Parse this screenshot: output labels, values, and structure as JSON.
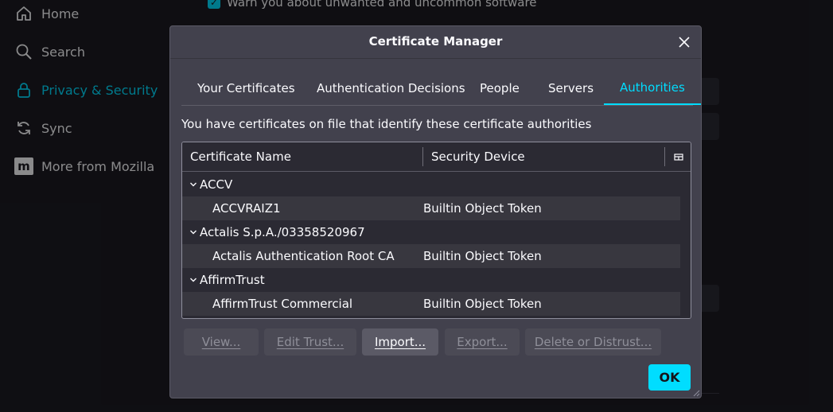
{
  "background": {
    "nav": [
      {
        "label": "Home",
        "icon": "home-icon"
      },
      {
        "label": "Search",
        "icon": "search-icon"
      },
      {
        "label": "Privacy & Security",
        "icon": "lock-icon",
        "active": true
      },
      {
        "label": "Sync",
        "icon": "sync-icon"
      },
      {
        "label": "More from Mozilla",
        "icon": "mozilla-icon"
      }
    ],
    "checkbox_label": "Warn you about unwanted and uncommon software",
    "mozilla_glyph": "m"
  },
  "dialog": {
    "title": "Certificate Manager",
    "tabs": [
      {
        "label": "Your Certificates"
      },
      {
        "label": "Authentication Decisions"
      },
      {
        "label": "People"
      },
      {
        "label": "Servers"
      },
      {
        "label": "Authorities",
        "active": true
      }
    ],
    "description": "You have certificates on file that identify these certificate authorities",
    "columns": [
      "Certificate Name",
      "Security Device"
    ],
    "rows": [
      {
        "type": "group",
        "name": "ACCV",
        "device": ""
      },
      {
        "type": "cert",
        "name": "ACCVRAIZ1",
        "device": "Builtin Object Token"
      },
      {
        "type": "group",
        "name": "Actalis S.p.A./03358520967",
        "device": ""
      },
      {
        "type": "cert",
        "name": "Actalis Authentication Root CA",
        "device": "Builtin Object Token"
      },
      {
        "type": "group",
        "name": "AffirmTrust",
        "device": ""
      },
      {
        "type": "cert",
        "name": "AffirmTrust Commercial",
        "device": "Builtin Object Token"
      }
    ],
    "buttons": [
      {
        "label": "View...",
        "enabled": false
      },
      {
        "label": "Edit Trust...",
        "enabled": false
      },
      {
        "label": "Import...",
        "enabled": true
      },
      {
        "label": "Export...",
        "enabled": false
      },
      {
        "label": "Delete or Distrust...",
        "enabled": false
      }
    ],
    "ok_label": "OK"
  },
  "colors": {
    "accent": "#00ddff",
    "dialog_bg": "#42414d",
    "page_bg": "#1c1b22"
  }
}
